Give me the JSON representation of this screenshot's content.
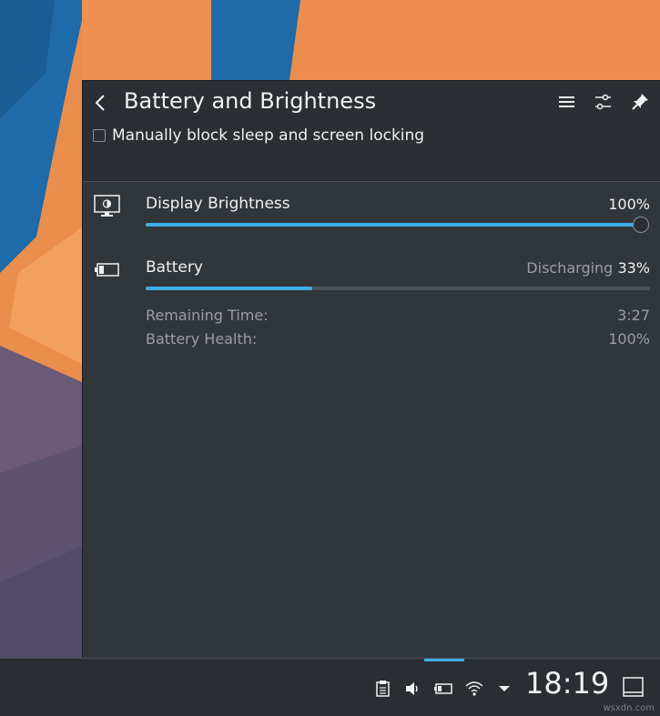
{
  "popup": {
    "title": "Battery and Brightness",
    "block_sleep_label": "Manually block sleep and screen locking",
    "block_sleep_checked": false
  },
  "brightness": {
    "label": "Display Brightness",
    "value_text": "100%",
    "level": 1.0
  },
  "battery": {
    "label": "Battery",
    "status": "Discharging",
    "percent_text": "33%",
    "level": 0.33,
    "remaining_label": "Remaining Time:",
    "remaining_value": "3:27",
    "health_label": "Battery Health:",
    "health_value": "100%"
  },
  "taskbar": {
    "clock": "18:19"
  },
  "watermark": "wsxdn.com",
  "colors": {
    "accent": "#3daee9",
    "panel": "#31363b",
    "text": "#eff0f1",
    "muted_text": "#9a9ea3"
  },
  "icons": {
    "back": "chevron-left-icon",
    "menu": "hamburger-menu-icon",
    "configure": "settings-sliders-icon",
    "pin": "pin-icon",
    "display": "monitor-brightness-icon",
    "battery": "battery-icon",
    "tray": [
      "clipboard-icon",
      "volume-icon",
      "battery-icon",
      "wifi-icon",
      "expand-tray-arrow-icon"
    ],
    "show_desktop": "show-desktop-icon"
  }
}
